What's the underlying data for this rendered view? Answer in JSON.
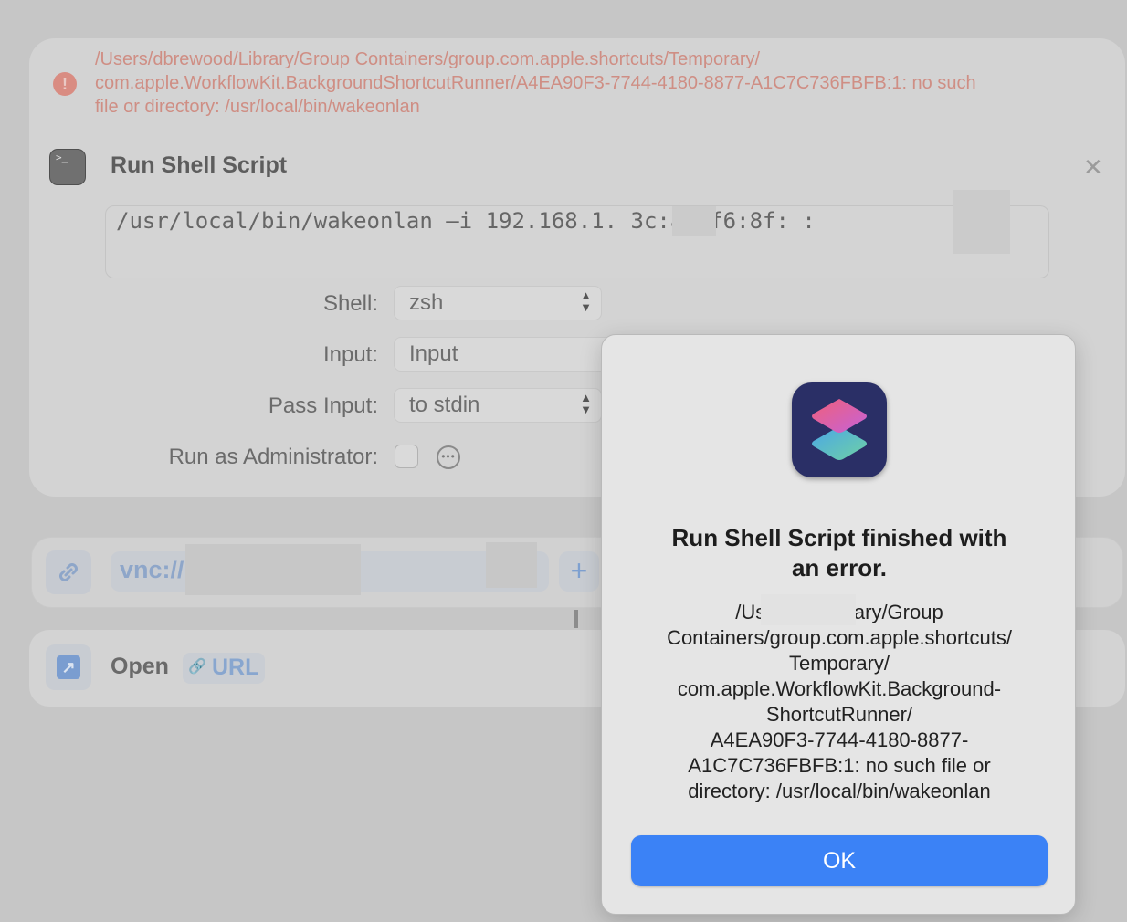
{
  "error_banner": {
    "lines": [
      "/Users/dbrewood/Library/Group Containers/group.com.apple.shortcuts/Temporary/",
      "com.apple.WorkflowKit.BackgroundShortcutRunner/A4EA90F3-7744-4180-8877-A1C7C736FBFB:1: no such",
      "file or directory: /usr/local/bin/wakeonlan"
    ]
  },
  "action": {
    "title": "Run Shell Script",
    "script_text": "/usr/local/bin/wakeonlan –i 192.168.1.    3c:a6:f6:8f:  :",
    "params": {
      "shell_label": "Shell:",
      "shell_value": "zsh",
      "input_label": "Input:",
      "input_value": "Input",
      "pass_input_label": "Pass Input:",
      "pass_input_value": "to stdin",
      "admin_label": "Run as Administrator:"
    }
  },
  "url_action": {
    "text": "vnc://                @192.168.1     )"
  },
  "open_action": {
    "label": "Open",
    "url_token": "URL"
  },
  "dialog": {
    "title_lines": [
      "Run Shell Script finished with",
      "an error."
    ],
    "message_lines": [
      "/Users/c              /Library/Group",
      "Containers/group.com.apple.shortcuts/",
      "Temporary/",
      "com.apple.WorkflowKit.Background-",
      "ShortcutRunner/",
      "A4EA90F3-7744-4180-8877-",
      "A1C7C736FBFB:1: no such file or",
      "directory: /usr/local/bin/wakeonlan"
    ],
    "ok_label": "OK"
  },
  "icons": {
    "error": "exclamation-circle-icon",
    "shell": "terminal-icon",
    "close": "close-icon",
    "link": "link-icon",
    "open": "arrow-up-right-icon",
    "app": "shortcuts-app-icon"
  },
  "colors": {
    "error_text": "#cf8e84",
    "accent_blue": "#3b82f6",
    "token_blue": "#88a6cf"
  }
}
